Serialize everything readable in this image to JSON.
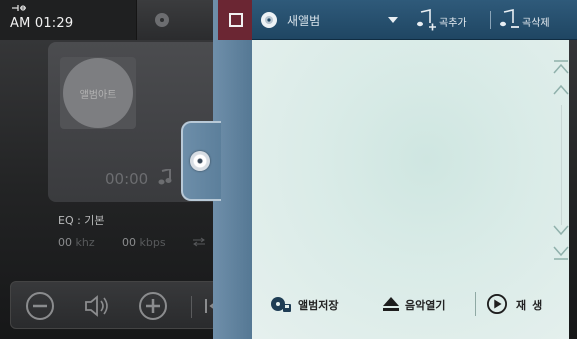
{
  "status_bar": {
    "time": "AM 01:29",
    "icon": "remote-signal-icon"
  },
  "player": {
    "album_art_text": "앨범아트",
    "time": "00:00",
    "eq": "EQ : 기본",
    "khz_value": "00",
    "khz_unit": "khz",
    "kbps_value": "00",
    "kbps_unit": "kbps",
    "controls": [
      "minus-icon",
      "speaker-icon",
      "plus-icon",
      "previous-icon"
    ]
  },
  "drawer": {
    "album_name": "새앨범",
    "add_song_label": "곡추가",
    "delete_song_label": "곡삭제",
    "actions": {
      "save_album": "앨범저장",
      "open_music": "음악열기",
      "play": "재생"
    }
  },
  "colors": {
    "header": "#1f4663",
    "checkbox_bg": "#6b2633",
    "panel": "#d9ebe7",
    "drawer_edge": "#6f8faa"
  }
}
